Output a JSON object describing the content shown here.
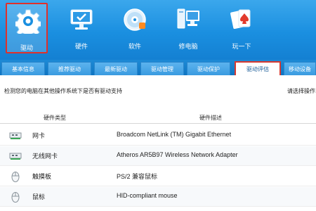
{
  "toolbar": {
    "items": [
      {
        "label": "驱动",
        "icon": "gear-icon"
      },
      {
        "label": "硬件",
        "icon": "monitor-icon"
      },
      {
        "label": "软件",
        "icon": "disc-icon"
      },
      {
        "label": "修电脑",
        "icon": "computer-repair-icon"
      },
      {
        "label": "玩一下",
        "icon": "cards-icon"
      }
    ],
    "active_index": 0
  },
  "tabs": {
    "items": [
      "基本信息",
      "推荐驱动",
      "最新驱动",
      "驱动管理",
      "驱动保护",
      "驱动评估",
      "移动设备"
    ],
    "active_index": 5
  },
  "description": "检测您的电脑在其他操作系统下是否有驱动支持",
  "hint": "请选择操作系统",
  "table": {
    "columns": [
      "硬件类型",
      "硬件描述"
    ],
    "rows": [
      {
        "type": "网卡",
        "description": "Broadcom NetLink (TM) Gigabit Ethernet",
        "icon": "network-card-icon"
      },
      {
        "type": "无线网卡",
        "description": "Atheros AR5B97 Wireless Network Adapter",
        "icon": "wireless-card-icon"
      },
      {
        "type": "触摸板",
        "description": "PS/2 兼容鼠标",
        "icon": "touchpad-icon"
      },
      {
        "type": "鼠标",
        "description": "HID-compliant mouse",
        "icon": "mouse-icon"
      }
    ]
  },
  "colors": {
    "accent": "#1a8fe0",
    "highlight": "#e0302a"
  }
}
